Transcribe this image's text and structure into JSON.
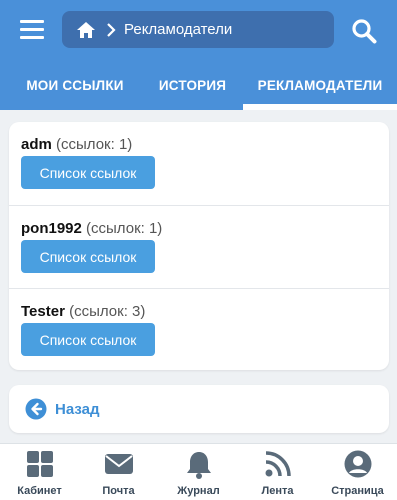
{
  "header": {
    "menu_icon": "hamburger-icon",
    "home_icon": "home-icon",
    "breadcrumb_title": "Рекламодатели",
    "search_icon": "search-icon"
  },
  "tabs": [
    {
      "label": "МОИ ССЫЛКИ",
      "active": false
    },
    {
      "label": "ИСТОРИЯ",
      "active": false
    },
    {
      "label": "РЕКЛАМОДАТЕЛИ",
      "active": true
    }
  ],
  "advertisers": [
    {
      "name": "adm",
      "count_text": "(ссылок: 1)",
      "button_label": "Список ссылок"
    },
    {
      "name": "pon1992",
      "count_text": "(ссылок: 1)",
      "button_label": "Список ссылок"
    },
    {
      "name": "Tester",
      "count_text": "(ссылок: 3)",
      "button_label": "Список ссылок"
    }
  ],
  "back": {
    "label": "Назад",
    "icon": "arrow-left-circle-icon"
  },
  "bottom_nav": [
    {
      "label": "Кабинет",
      "icon": "grid-icon"
    },
    {
      "label": "Почта",
      "icon": "mail-icon"
    },
    {
      "label": "Журнал",
      "icon": "bell-icon"
    },
    {
      "label": "Лента",
      "icon": "rss-icon"
    },
    {
      "label": "Страница",
      "icon": "user-icon"
    }
  ],
  "colors": {
    "header_bg": "#4a90d9",
    "breadcrumb_bg": "#3e6fae",
    "button_bg": "#4a9fe0",
    "link_color": "#3e8fd6",
    "nav_icon": "#5a6b7a"
  }
}
